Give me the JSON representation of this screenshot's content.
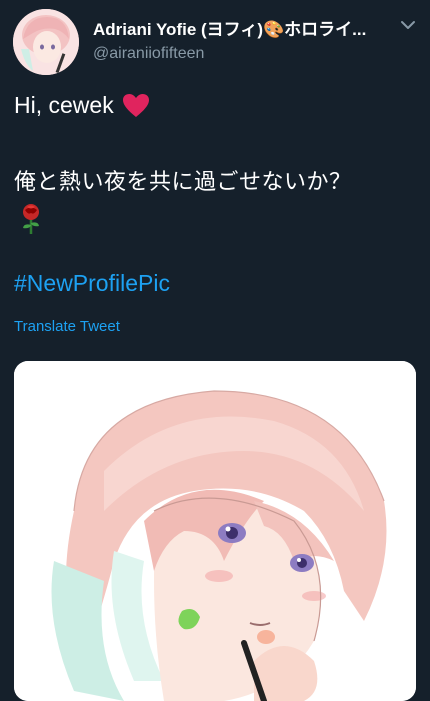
{
  "tweet": {
    "display_name": "Adriani Yofie (ヨフィ)🎨ホロライ...",
    "handle": "@airaniiofifteen",
    "text_line1": "Hi, cewek",
    "text_line2": "俺と熱い夜を共に過ごせないか？",
    "hashtag": "#NewProfilePic",
    "translate_label": "Translate Tweet"
  },
  "icons": {
    "menu": "chevron-down-icon",
    "heart": "heart-emoji",
    "rose": "rose-emoji"
  },
  "colors": {
    "background": "#15202b",
    "link": "#1da1f2",
    "secondary_text": "#8899a6",
    "heart": "#e0245e"
  }
}
